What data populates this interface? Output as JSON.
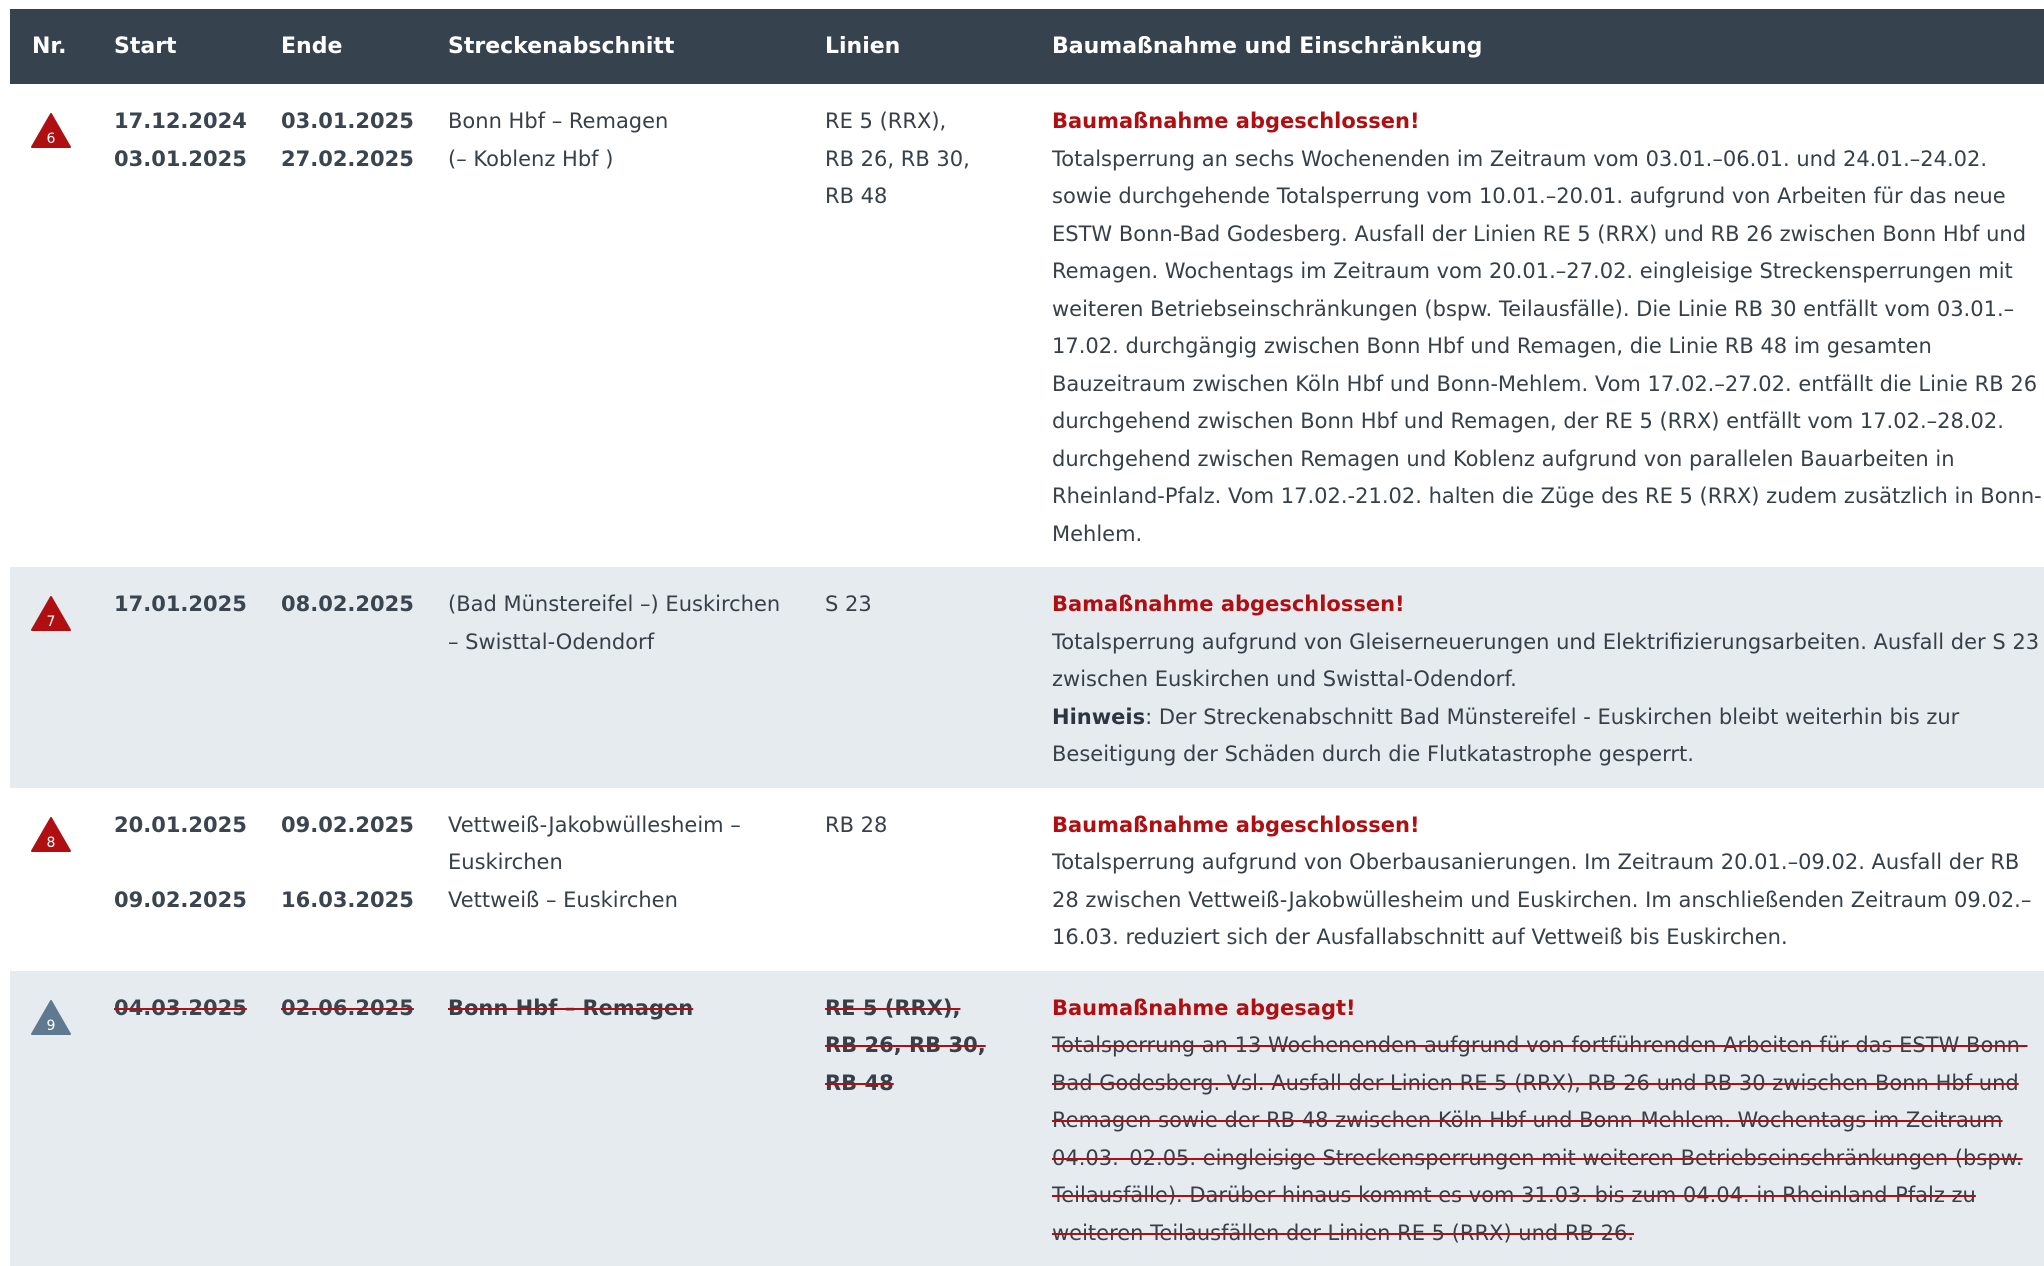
{
  "header": {
    "nr": "Nr.",
    "start": "Start",
    "ende": "Ende",
    "strecke": "Streckenabschnitt",
    "linien": "Linien",
    "massnahme": "Baumaßnahme und Einschränkung"
  },
  "colors": {
    "header_bg": "#36434f",
    "row_grey": "#e6ebf0",
    "status_red": "#b00f12",
    "warn_red": "#b00f12",
    "warn_grey": "#5f7a90"
  },
  "rows": [
    {
      "nr": "6",
      "icon": "warning-triangle-icon",
      "start": [
        "17.12.2024",
        "03.01.2025"
      ],
      "ende": [
        "03.01.2025",
        "27.02.2025"
      ],
      "strecke": [
        "Bonn Hbf – Remagen",
        "(– Koblenz Hbf )"
      ],
      "linien": [
        "RE 5 (RRX),",
        "RB 26, RB 30,",
        "RB 48"
      ],
      "status": "Baumaßnahme abgeschlossen!",
      "text": "Totalsperrung an sechs Wochenenden im Zeitraum vom 03.01.–06.01. und 24.01.–24.02. sowie durchgehende Totalsperrung vom 10.01.–20.01. aufgrund von Arbeiten für das neue ESTW Bonn-Bad Godesberg. Ausfall der Linien RE 5 (RRX) und RB 26 zwischen Bonn Hbf und Remagen. Wochentags im Zeitraum vom 20.01.–27.02. eingleisige Streckensperrungen mit weiteren Betriebseinschränkungen (bspw. Teilausfälle). Die Linie RB 30 entfällt vom 03.01.–17.02. durchgängig zwischen Bonn Hbf und Remagen, die Linie RB 48 im gesamten Bauzeitraum zwischen Köln Hbf und Bonn-Mehlem. Vom 17.02.–27.02. entfällt die Linie RB 26 durchgehend zwischen Bonn Hbf und Remagen, der RE 5 (RRX) entfällt vom 17.02.–28.02. durchgehend zwischen Remagen und Koblenz aufgrund von parallelen Bauarbeiten in Rheinland-Pfalz. Vom 17.02.-21.02. halten die Züge des RE 5 (RRX) zudem zusätzlich in Bonn-Mehlem."
    },
    {
      "nr": "7",
      "icon": "warning-triangle-icon",
      "start": [
        "17.01.2025"
      ],
      "ende": [
        "08.02.2025"
      ],
      "strecke": [
        "(Bad Münstereifel –) Euskirchen",
        "– Swisttal-Odendorf"
      ],
      "linien": [
        "S 23"
      ],
      "status": "Bamaßnahme abgeschlossen!",
      "text": "Totalsperrung aufgrund von Gleiserneuerungen und Elektrifizierungsarbeiten. Ausfall der S 23 zwischen Euskirchen und Swisttal-Odendorf.",
      "note_label": "Hinweis",
      "note_text": ": Der Streckenabschnitt Bad Münstereifel - Euskirchen bleibt weiterhin bis zur Beseitigung der Schäden durch die Flutkatastrophe gesperrt."
    },
    {
      "nr": "8",
      "icon": "warning-triangle-icon",
      "start": [
        "20.01.2025",
        "09.02.2025"
      ],
      "ende": [
        "09.02.2025",
        "16.03.2025"
      ],
      "strecke": [
        "Vettweiß-Jakobwüllesheim –",
        "Euskirchen",
        "Vettweiß – Euskirchen"
      ],
      "linien": [
        "RB 28"
      ],
      "status": "Baumaßnahme abgeschlossen!",
      "text": "Totalsperrung aufgrund von Oberbausanierungen. Im Zeitraum 20.01.–09.02. Ausfall der RB 28 zwischen Vettweiß-Jakobwüllesheim und Euskirchen. Im anschließenden Zeitraum 09.02.–16.03. reduziert sich der Ausfallabschnitt auf Vettweiß bis Euskirchen."
    },
    {
      "nr": "9",
      "icon": "warning-triangle-icon",
      "start": [
        "04.03.2025"
      ],
      "ende": [
        "02.06.2025"
      ],
      "strecke": [
        "Bonn Hbf – Remagen"
      ],
      "linien": [
        "RE 5 (RRX),",
        "RB 26, RB 30,",
        "RB 48"
      ],
      "status": "Baumaßnahme abgesagt!",
      "text": "Totalsperrung an 13 Wochenenden aufgrund von fortführenden Arbeiten für das ESTW Bonn-Bad Godesberg. Vsl. Ausfall der Linien RE 5 (RRX), RB 26 und RB 30 zwischen Bonn Hbf und Remagen sowie der RB 48 zwischen Köln Hbf und Bonn-Mehlem. Wochentags im Zeitraum 04.03.–02.05. eingleisige Streckensperrungen mit weiteren Betriebseinschränkungen (bspw. Teilausfälle). Darüber hinaus kommt es vom 31.03. bis zum 04.04. in Rheinland-Pfalz zu weiteren Teilausfällen der Linien RE 5 (RRX) und RB 26."
    }
  ]
}
